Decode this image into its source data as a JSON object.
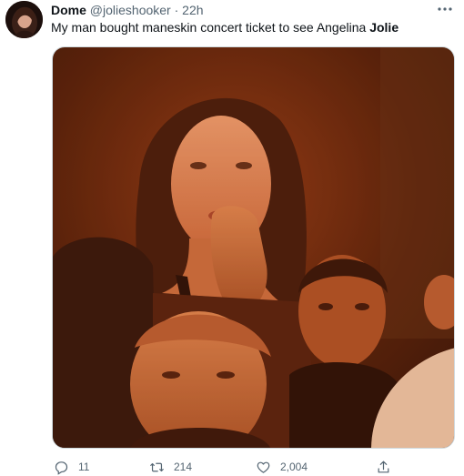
{
  "author": {
    "display_name": "Dome",
    "handle": "@jolieshooker",
    "separator": "·",
    "time": "22h",
    "more_icon": "more-horizontal-icon"
  },
  "tweet": {
    "text_prefix": "My man bought maneskin concert ticket to see Angelina ",
    "text_bold": "Jolie"
  },
  "media": {
    "description_icon": "photo",
    "tint": "#c85a22"
  },
  "actions": {
    "reply_count": "11",
    "retweet_count": "214",
    "like_count": "2,004"
  }
}
